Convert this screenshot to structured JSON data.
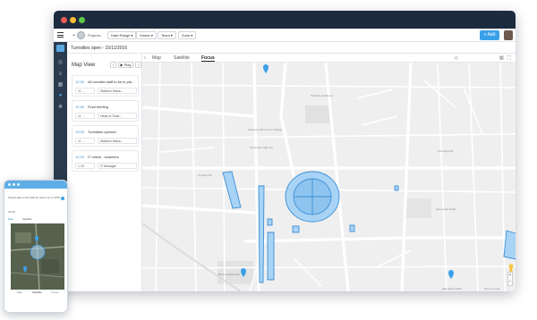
{
  "topbar": {
    "project": "Projects",
    "filters": [
      "Date Range",
      "Owner",
      "Team",
      "Zone"
    ],
    "add_label": "+ Add"
  },
  "subhead": {
    "title": "Turnstiles open - 15/11/2016"
  },
  "panel": {
    "title": "Map View",
    "play_label": "▶ Play",
    "cards": [
      {
        "time": "12:30",
        "text": "All turnstile staff to be in pla...",
        "people": "11 ...",
        "role": "Stadium Mana..."
      },
      {
        "time": "12:45",
        "text": "Final briefing",
        "people": "11 ...",
        "role": "Head of Ticke..."
      },
      {
        "time": "13:00",
        "text": "Turnstiles opened",
        "people": "11 ...",
        "role": "Stadium Mana..."
      },
      {
        "time": "13:15",
        "text": "IT check - scanners",
        "people": "1 Cll",
        "role": "IT Manager"
      }
    ]
  },
  "map": {
    "tabs": [
      "Map",
      "Satellite",
      "Focus"
    ],
    "active_tab": "Focus",
    "labels": [
      "Croydon Rd",
      "Haringey Sixth Form College",
      "Tottenham High Rd",
      "Parkside Academy",
      "Bruce Castle Park",
      "Fernleigh Rd",
      "Sunnyside Road"
    ],
    "attribution": "Map data ©2016",
    "terms": "Terms of Use",
    "accent_color": "#3aa0e8"
  },
  "phone": {
    "heading": "Teams take to the field for warm up on POP",
    "time": "13:00",
    "tabs": [
      "Map",
      "Satellite",
      "Focus"
    ]
  }
}
